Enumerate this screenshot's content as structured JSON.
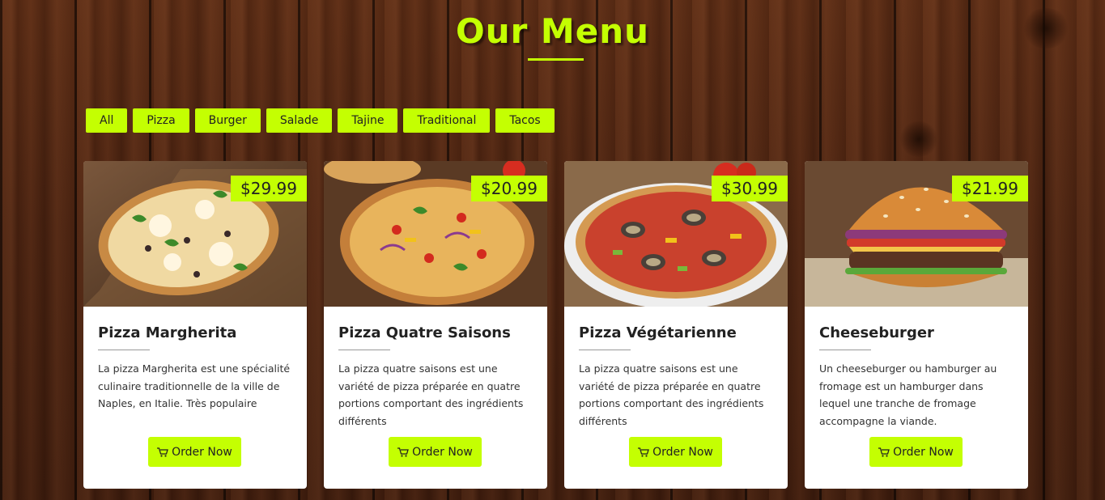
{
  "page": {
    "title": "Our Menu",
    "accent_color": "#c4ff02"
  },
  "filters": [
    {
      "label": "All"
    },
    {
      "label": "Pizza"
    },
    {
      "label": "Burger"
    },
    {
      "label": "Salade"
    },
    {
      "label": "Tajine"
    },
    {
      "label": "Traditional"
    },
    {
      "label": "Tacos"
    }
  ],
  "cards": [
    {
      "image": "pizza-margherita-photo",
      "price": "$29.99",
      "title": "Pizza Margherita",
      "description": "La pizza Margherita est une spécialité culinaire traditionnelle de la ville de Naples, en Italie. Très populaire",
      "button_label": "Order Now",
      "button_icon": "cart-icon"
    },
    {
      "image": "pizza-quatre-saisons-photo",
      "price": "$20.99",
      "title": "Pizza Quatre Saisons",
      "description": "La pizza quatre saisons est une variété de pizza préparée en quatre portions comportant des ingrédients différents",
      "button_label": "Order Now",
      "button_icon": "cart-icon"
    },
    {
      "image": "pizza-vegetarienne-photo",
      "price": "$30.99",
      "title": "Pizza Végétarienne",
      "description": "La pizza quatre saisons est une variété de pizza préparée en quatre portions comportant des ingrédients différents",
      "button_label": "Order Now",
      "button_icon": "cart-icon"
    },
    {
      "image": "cheeseburger-photo",
      "price": "$21.99",
      "title": "Cheeseburger",
      "description": "Un cheeseburger ou hamburger au fromage est un hamburger dans lequel une tranche de fromage accompagne la viande.",
      "button_label": "Order Now",
      "button_icon": "cart-icon"
    }
  ]
}
